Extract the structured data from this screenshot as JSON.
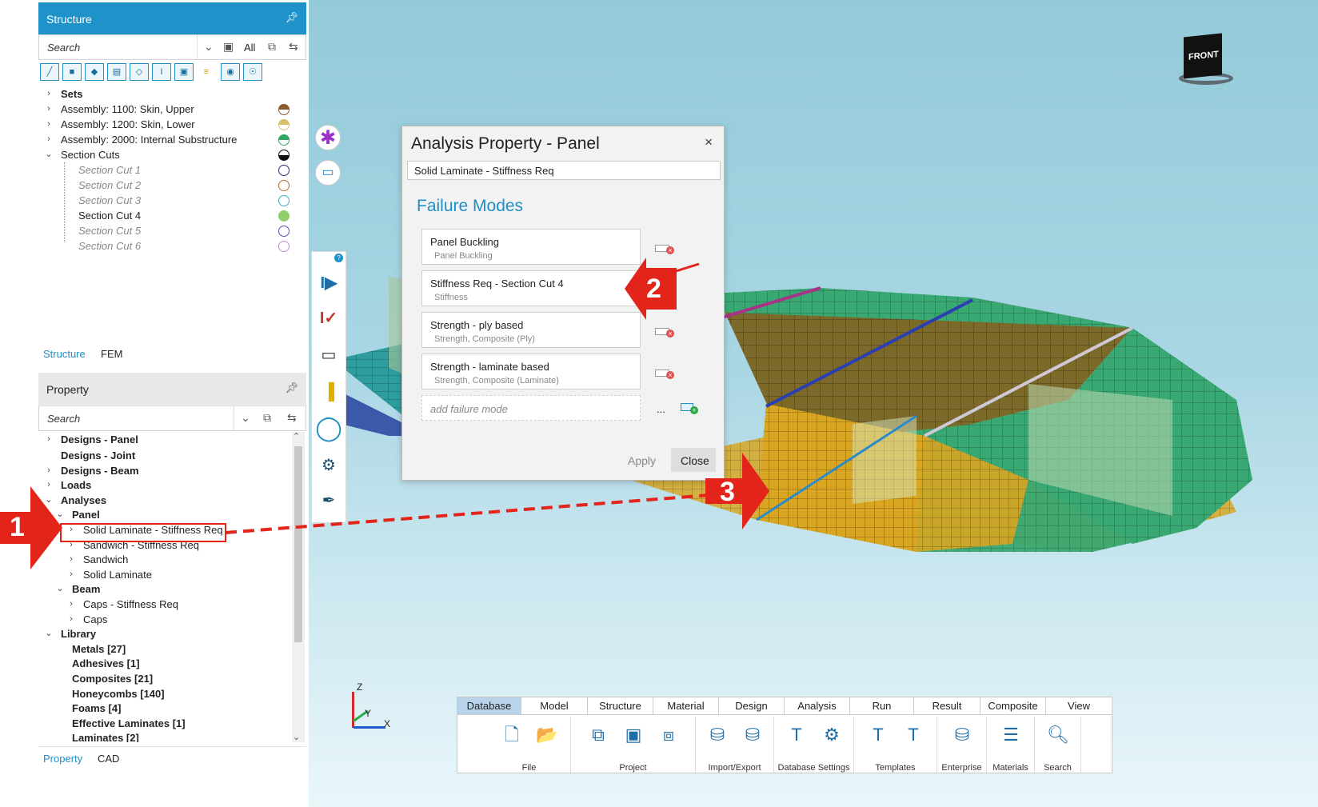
{
  "structure_panel": {
    "title": "Structure",
    "search_placeholder": "Search",
    "filter_label": "All",
    "tree": [
      {
        "label": "Sets",
        "bold": true
      },
      {
        "label": "Assembly: 1100: Skin, Upper",
        "color": "#8a5a2b"
      },
      {
        "label": "Assembly: 1200: Skin, Lower",
        "color": "#d8c06a"
      },
      {
        "label": "Assembly: 2000: Internal Substructure",
        "color": "#2eaa5e"
      },
      {
        "label": "Section Cuts",
        "color": "#111111"
      },
      {
        "label": "Section Cut 1",
        "color": "#2a2e7a"
      },
      {
        "label": "Section Cut 2",
        "color": "#b0703a"
      },
      {
        "label": "Section Cut 3",
        "color": "#3ab0c8"
      },
      {
        "label": "Section Cut 4",
        "color": "#8fd06a"
      },
      {
        "label": "Section Cut 5",
        "color": "#6a4aa8"
      },
      {
        "label": "Section Cut 6",
        "color": "#c08ad0"
      }
    ],
    "tabs": [
      "Structure",
      "FEM"
    ]
  },
  "property_panel": {
    "title": "Property",
    "search_placeholder": "Search",
    "tree": [
      "Designs - Panel",
      "Designs - Joint",
      "Designs - Beam",
      "Loads",
      "Analyses",
      "Panel",
      "Solid Laminate - Stiffness Req",
      "Sandwich - Stiffness Req",
      "Sandwich",
      "Solid Laminate",
      "Beam",
      "Caps - Stiffness Req",
      "Caps",
      "Library",
      "Metals [27]",
      "Adhesives [1]",
      "Composites [21]",
      "Honeycombs [140]",
      "Foams [4]",
      "Effective Laminates [1]",
      "Laminates [2]"
    ],
    "tabs": [
      "Property",
      "CAD"
    ]
  },
  "dialog": {
    "title": "Analysis Property - Panel",
    "property_name": "Solid Laminate - Stiffness Req",
    "section_title": "Failure Modes",
    "failure_modes": [
      {
        "name": "Panel Buckling",
        "sub": "Panel Buckling"
      },
      {
        "name": "Stiffness Req - Section Cut 4",
        "sub": "Stiffness"
      },
      {
        "name": "Strength - ply based",
        "sub": "Strength, Composite (Ply)"
      },
      {
        "name": "Strength - laminate based",
        "sub": "Strength, Composite (Laminate)"
      }
    ],
    "add_placeholder": "add failure mode",
    "more_label": "...",
    "apply_label": "Apply",
    "close_label": "Close",
    "close_icon": "×"
  },
  "viewcube": {
    "label": "FRONT"
  },
  "axes": {
    "z": "Z",
    "y": "Y",
    "x": "X"
  },
  "callouts": [
    "1",
    "2",
    "3"
  ],
  "ribbon": {
    "tabs": [
      "Database",
      "Model",
      "Structure",
      "Material",
      "Design",
      "Analysis",
      "Run",
      "Result",
      "Composite",
      "View"
    ],
    "active_tab": "Database",
    "groups": [
      "File",
      "Project",
      "Import/Export",
      "Database Settings",
      "Templates",
      "Enterprise",
      "Materials",
      "Search"
    ]
  },
  "colors": {
    "header_blue": "#1f93c9",
    "accent": "#1f8fc7",
    "callout_red": "#e2241b",
    "mesh_green": "#3aa872",
    "mesh_gold": "#d8a623"
  }
}
